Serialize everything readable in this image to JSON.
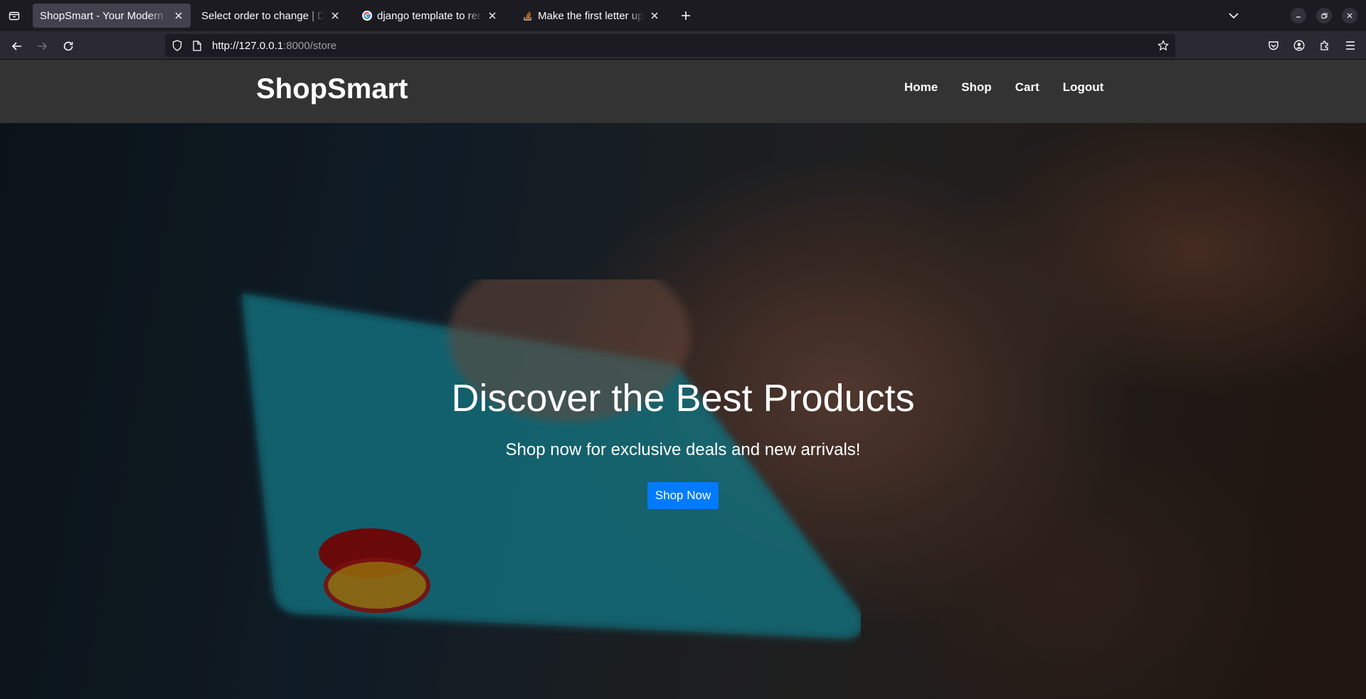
{
  "browser": {
    "tabs": [
      {
        "title": "ShopSmart - Your Modern E-",
        "active": true,
        "favicon": "none"
      },
      {
        "title": "Select order to change | Djan",
        "active": false,
        "favicon": "none"
      },
      {
        "title": "django template to render",
        "active": false,
        "favicon": "google-icon"
      },
      {
        "title": "Make the first letter uppe",
        "active": false,
        "favicon": "stackoverflow-icon"
      }
    ],
    "url": {
      "host": "http://127.0.0.1",
      "rest": ":8000/store"
    }
  },
  "site": {
    "logo": "ShopSmart",
    "nav": [
      "Home",
      "Shop",
      "Cart",
      "Logout"
    ]
  },
  "hero": {
    "title": "Discover the Best Products",
    "subtitle": "Shop now for exclusive deals and new arrivals!",
    "button_label": "Shop Now",
    "button_color": "#007bff",
    "card_color": "#1aa3b5"
  }
}
